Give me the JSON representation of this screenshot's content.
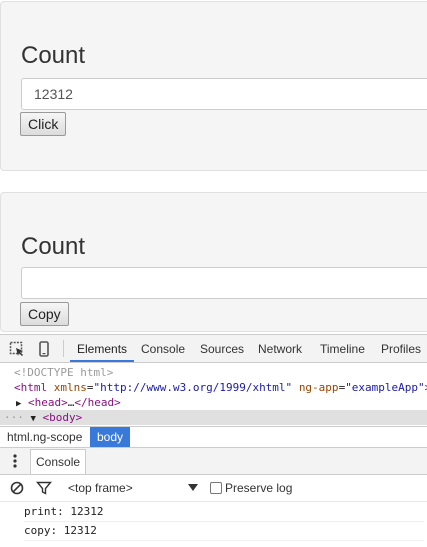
{
  "panel1": {
    "heading": "Count",
    "input_value": "12312",
    "button_label": "Click"
  },
  "panel2": {
    "heading": "Count",
    "input_value": "",
    "button_label": "Copy"
  },
  "devtools": {
    "tabs": [
      "Elements",
      "Console",
      "Sources",
      "Network",
      "Timeline",
      "Profiles"
    ],
    "active_tab": "Elements",
    "dom": {
      "doctype": "<!DOCTYPE html>",
      "html_open": "<html",
      "xmlns_attr": "xmlns",
      "xmlns_val": "\"http://www.w3.org/1999/xhtml\"",
      "ngapp_attr": "ng-app",
      "ngapp_val": "\"exampleApp\"",
      "html_close_bracket": ">",
      "head_open": "<head>",
      "ellipsis": "…",
      "head_close": "</head>",
      "body_dots": "···",
      "body_tag": "<body>"
    },
    "breadcrumbs": {
      "html": "html.ng-scope",
      "body": "body"
    },
    "drawer_tab": "Console",
    "console_toolbar": {
      "frame": "<top frame>",
      "preserve_log": "Preserve log"
    },
    "logs": [
      "print: 12312",
      "copy: 12312"
    ]
  },
  "colors": {
    "accent": "#3879d9",
    "panel_bg": "#f5f5f5",
    "tag": "#881280",
    "attr": "#994500",
    "value": "#1a1aa6"
  }
}
